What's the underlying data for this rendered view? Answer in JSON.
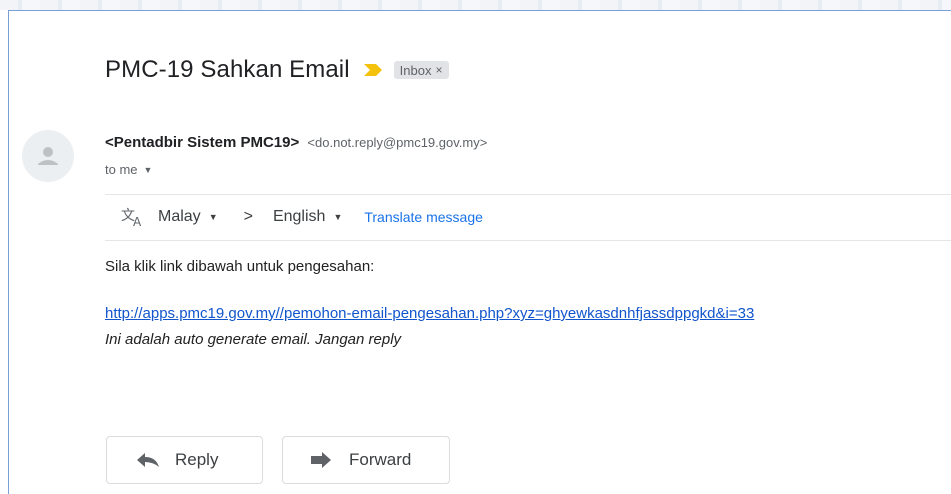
{
  "email": {
    "subject": "PMC-19 Sahkan Email",
    "label_chip": "Inbox",
    "label_chip_close": "×",
    "sender_name": "<Pentadbir Sistem PMC19>",
    "sender_email": "<do.not.reply@pmc19.gov.my>",
    "recipient": "to me",
    "body": {
      "line1": "Sila klik link dibawah untuk pengesahan:",
      "link": "http://apps.pmc19.gov.my//pemohon-email-pengesahan.php?xyz=ghyewkasdnhfjassdppgkd&i=33",
      "line3": "Ini adalah auto generate email. Jangan reply"
    }
  },
  "translate": {
    "from_lang": "Malay",
    "arrow": ">",
    "to_lang": "English",
    "action": "Translate message"
  },
  "actions": {
    "reply": "Reply",
    "forward": "Forward"
  },
  "colors": {
    "importance": "#f4c20d",
    "link": "#1155cc",
    "translate_link": "#1a73e8",
    "chip_bg": "#e1e3e6"
  },
  "icons": {
    "importance": "importance-marker-icon",
    "avatar": "person-avatar-icon",
    "translate": "translate-icon",
    "reply": "reply-arrow-icon",
    "forward": "forward-arrow-icon"
  }
}
